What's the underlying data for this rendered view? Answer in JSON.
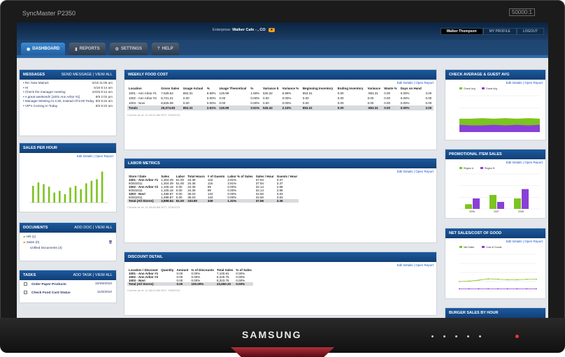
{
  "monitor": {
    "model": "SyncMaster P2350",
    "spec": "50000:1",
    "brand": "SAMSUNG"
  },
  "enterprise": {
    "label": "Enterprise:",
    "value": "Walker Cafe - , CO"
  },
  "user": {
    "name": "Walker Thompson",
    "profile": "MY PROFILE",
    "logout": "LOGOUT"
  },
  "tabs": [
    "DASHBOARD",
    "REPORTS",
    "SETTINGS",
    "HELP"
  ],
  "messages": {
    "title": "MESSAGES",
    "actions": "SEND MESSAGE | VIEW ALL",
    "items": [
      {
        "t": "Re: New Maines",
        "d": "5/19 11:05 am"
      },
      {
        "t": "Hi",
        "d": "5/18  8:14 am"
      },
      {
        "t": "Check the manager meeting",
        "d": "10/26  8:12 am"
      },
      {
        "t": "A great weekend!! [1001 Ann Arbor #1]",
        "d": "8/9  2:02 pm"
      },
      {
        "t": "Manager Meeting At 4:30, Instead Of 5:00 Today",
        "d": "8/6  9:22 am"
      },
      {
        "t": "VIP's Coming In Today",
        "d": "8/6  9:22 am"
      }
    ]
  },
  "sales_hour": {
    "title": "SALES PER HOUR",
    "links": "Edit Details | Open Report"
  },
  "documents": {
    "title": "DOCUMENTS",
    "actions": "ADD DOC | VIEW ALL",
    "items": [
      "HR (1)",
      "Sales (0)",
      "Unfiled Documents (4)"
    ]
  },
  "tasks": {
    "title": "TASKS",
    "actions": "ADD TASK | VIEW ALL",
    "items": [
      {
        "t": "Order Paper Products",
        "d": "10/26/2010"
      },
      {
        "t": "Check Food Card Status",
        "d": "11/5/2010"
      }
    ]
  },
  "food": {
    "title": "WEEKLY FOOD COST",
    "links": "Edit Details | Open Report",
    "headers": [
      "Location",
      "Gross Sales",
      "Usage Actual",
      "%",
      "Usage Theoretical",
      "%",
      "Variance $",
      "Variance %",
      "Beginning Inventory",
      "Ending Inventory",
      "Variance",
      "Waste %",
      "Days on Hand"
    ],
    "rows": [
      [
        "1001 - Ann Arbor #1",
        "7,528.54",
        "853.31",
        "8.68%",
        "126.99",
        "1.69%",
        "526.32",
        "6.99%",
        "853.31",
        "0.00",
        "-853.31",
        "0.00",
        "0.00%",
        "3.00"
      ],
      [
        "1002 - Ann Arbor #2",
        "8,721.21",
        "0.00",
        "0.00%",
        "0.00",
        "0.00%",
        "0.00",
        "0.00%",
        "0.00",
        "0.00",
        "0.00",
        "0.00",
        "0.00%",
        "0.00"
      ],
      [
        "1003 - Novi",
        "8,825.08",
        "0.00",
        "0.00%",
        "0.00",
        "0.00%",
        "0.00",
        "0.00%",
        "0.00",
        "0.00",
        "0.00",
        "0.00",
        "0.00%",
        "0.00"
      ],
      [
        "Totals",
        "25,074.83",
        "853.31",
        "2.61%",
        "126.99",
        "0.51%",
        "526.32",
        "2.10%",
        "853.31",
        "0.00",
        "-853.31",
        "0.00",
        "0.00%",
        "3.00"
      ]
    ],
    "footer": "Current as of: 11:43:43 AM EDT, 9/26/2011"
  },
  "labor": {
    "title": "LABOR METRICS",
    "links": "Edit Details | Open Report",
    "headers": [
      "Store / Date",
      "Sales",
      "Labor",
      "Total Hours",
      "# of Guests",
      "Labor % of Sales",
      "Sales / Hour",
      "Guests / Hour"
    ],
    "rows": [
      [
        "1001 - Ann Arbor #1",
        "1,304.49",
        "51.00",
        "34.38",
        "116",
        "3.91%",
        "37.94",
        "3.37"
      ],
      [
        "9/25/2011",
        "1,304.49",
        "51.00",
        "34.38",
        "116",
        "3.91%",
        "37.94",
        "3.37"
      ],
      [
        "1002 - Ann Arbor #2",
        "1,105.18",
        "0.00",
        "34.39",
        "99",
        "0.00%",
        "32.14",
        "2.88"
      ],
      [
        "9/25/2011",
        "1,105.18",
        "0.00",
        "34.39",
        "99",
        "0.00%",
        "32.14",
        "2.88"
      ],
      [
        "1003 - Novi",
        "1,488.87",
        "0.00",
        "35.03",
        "134",
        "0.00%",
        "42.50",
        "3.83"
      ],
      [
        "9/25/2011",
        "1,488.87",
        "0.00",
        "35.03",
        "134",
        "0.00%",
        "42.50",
        "3.83"
      ],
      [
        "Total (All Stores)",
        "3,898.54",
        "51.00",
        "103.80",
        "349",
        "1.31%",
        "37.56",
        "3.36"
      ]
    ],
    "footer": "Current as of: 11:43:45 AM EDT, 9/26/2011"
  },
  "discount": {
    "title": "DISCOUNT DETAIL",
    "links": "Edit Details | Open Report",
    "headers": [
      "Location / Discount",
      "Quantity",
      "Amount",
      "% of Discounts",
      "Total Sales",
      "% of Sales"
    ],
    "rows": [
      [
        "1001 - Ann Arbor #1",
        "",
        "0.00",
        "0.00%",
        "7,100.81",
        "0.00%"
      ],
      [
        "1002 - Ann Arbor #2",
        "",
        "0.00",
        "0.00%",
        "8,225.76",
        "0.00%"
      ],
      [
        "1003 - Novi",
        "",
        "0.00",
        "0.00%",
        "8,323.76",
        "0.00%"
      ],
      [
        "Total (All Stores)",
        "",
        "0.00",
        "100.00%",
        "23,650.33",
        "0.00%"
      ]
    ],
    "footer": "Current as of: 11:48:43 AM EDT, 9/26/2011"
  },
  "check_avg": {
    "title": "CHECK AVERAGE & GUEST AVG",
    "links": "Edit Details | Open Report",
    "legend": [
      "Check Avg",
      "Guest Avg"
    ]
  },
  "promo": {
    "title": "PROMOTIONAL ITEM SALES",
    "links": "Edit Details | Open Report",
    "legend": [
      "Region A",
      "Region B"
    ]
  },
  "net_sales": {
    "title": "NET SALES/COST OF GOOD",
    "links": "Edit Details | Open Report",
    "legend": [
      "Net Sales",
      "Cost of Goods"
    ]
  },
  "burger": {
    "title": "BURGER SALES BY HOUR"
  },
  "chart_data": [
    {
      "type": "bar",
      "name": "sales_per_hour",
      "values": [
        20,
        24,
        22,
        19,
        12,
        14,
        10,
        18,
        20,
        16,
        23,
        26,
        28,
        37
      ]
    },
    {
      "type": "area",
      "name": "check_avg",
      "series": [
        {
          "name": "Check Avg",
          "values": [
            22,
            22,
            23,
            22,
            23,
            22,
            23,
            22
          ]
        },
        {
          "name": "Guest Avg",
          "values": [
            12,
            11,
            11,
            12,
            11,
            12,
            11,
            12
          ]
        }
      ],
      "ylim": [
        0,
        60
      ]
    },
    {
      "type": "bar",
      "name": "promo",
      "categories": [
        "2006",
        "2007",
        "2008"
      ],
      "series": [
        {
          "name": "Region A",
          "values": [
            20,
            60,
            45
          ]
        },
        {
          "name": "Region B",
          "values": [
            45,
            30,
            85
          ]
        }
      ],
      "ylim": [
        0,
        150
      ]
    },
    {
      "type": "line",
      "name": "net_sales",
      "series": [
        {
          "name": "Net Sales",
          "values": [
            2.0,
            2.1,
            2.3,
            2.6,
            2.5,
            2.4,
            2.4,
            2.5,
            2.5
          ]
        },
        {
          "name": "Cost of Goods",
          "values": [
            0.4,
            0.4,
            0.4,
            0.4,
            0.4,
            0.4,
            0.4,
            0.4,
            0.4
          ]
        }
      ],
      "ylim": [
        0,
        8
      ]
    }
  ]
}
